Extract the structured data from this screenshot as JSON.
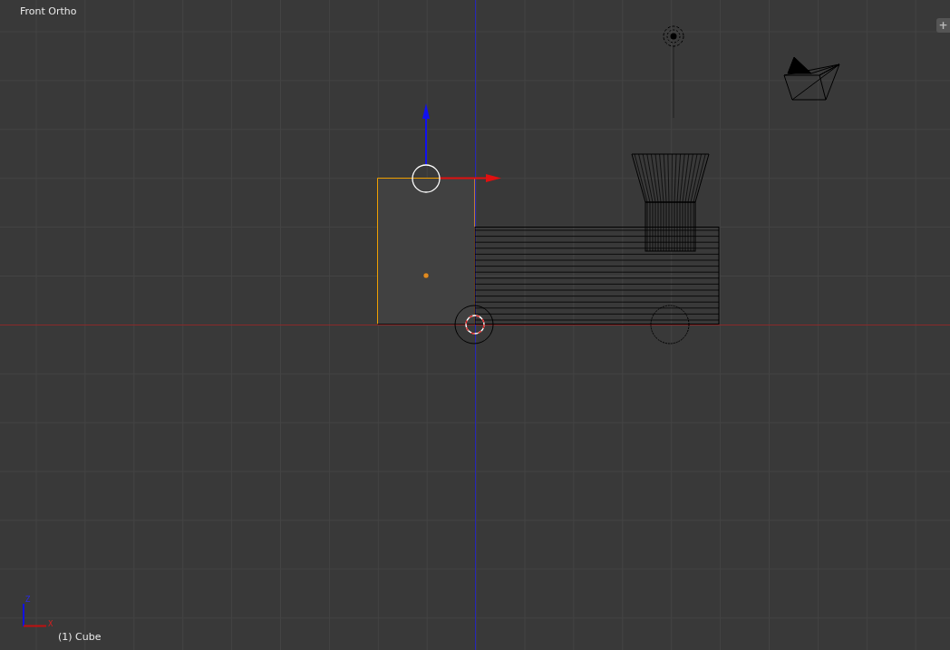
{
  "viewport": {
    "title": "Front Ortho",
    "object_label": "(1) Cube",
    "axis_labels": [
      "Z",
      "X"
    ],
    "add_button": "+"
  }
}
